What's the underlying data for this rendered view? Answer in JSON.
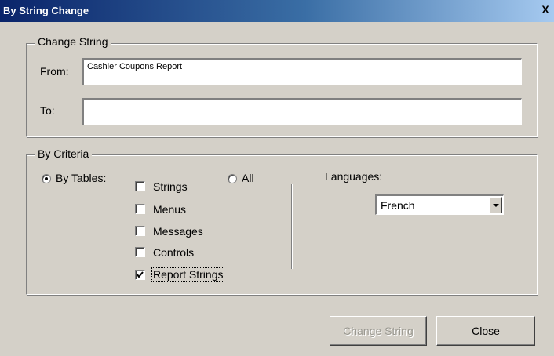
{
  "window": {
    "title": "By String Change",
    "close_glyph": "X"
  },
  "change_string_group": {
    "legend": "Change String",
    "from_label": "From:",
    "from_value": "Cashier Coupons Report",
    "to_label": "To:",
    "to_value": ""
  },
  "criteria_group": {
    "legend": "By Criteria",
    "by_tables_label": "By Tables:",
    "by_tables_selected": true,
    "all_label": "All",
    "all_selected": false,
    "tables": [
      {
        "label": "Strings",
        "checked": false
      },
      {
        "label": "Menus",
        "checked": false
      },
      {
        "label": "Messages",
        "checked": false
      },
      {
        "label": "Controls",
        "checked": false
      },
      {
        "label": "Report Strings",
        "checked": true
      }
    ],
    "languages_label": "Languages:",
    "language_selected": "French"
  },
  "buttons": {
    "change_string_label": "Change String",
    "close_prefix": "C",
    "close_rest": "lose"
  },
  "colors": {
    "dialog_bg": "#d4d0c8",
    "titlebar_start": "#0a246a",
    "titlebar_end": "#a6caf0"
  },
  "icons": {
    "close": "close-icon",
    "dropdown": "chevron-down-icon"
  }
}
